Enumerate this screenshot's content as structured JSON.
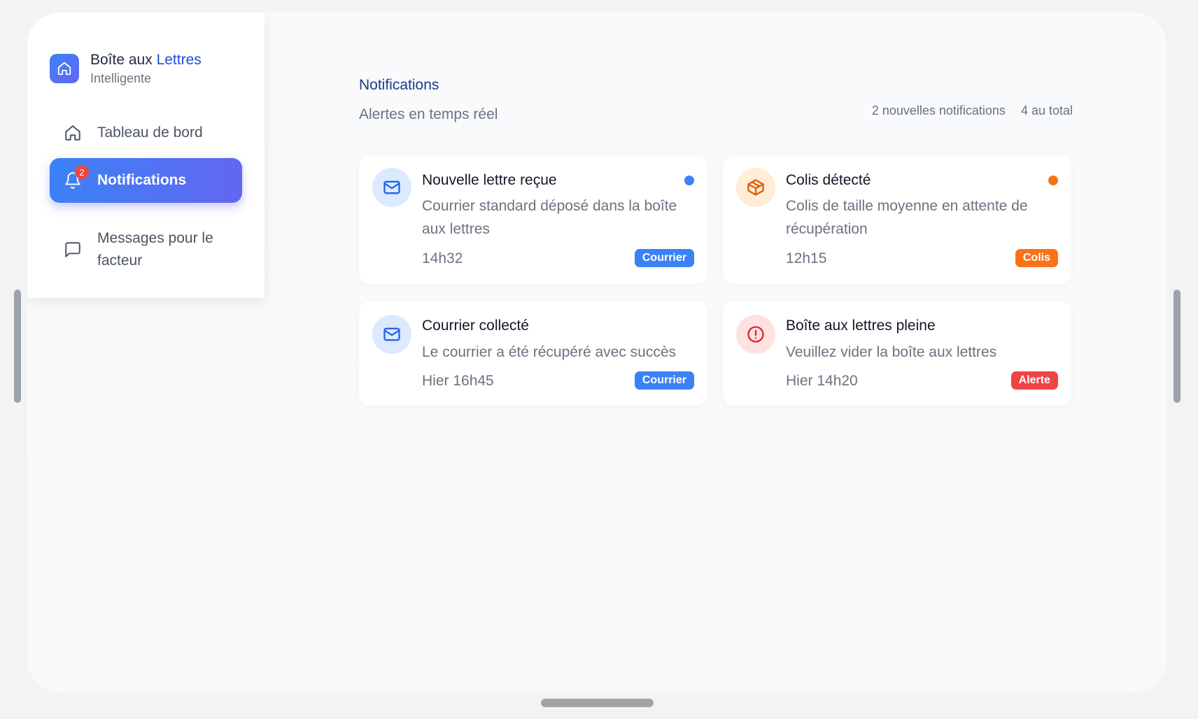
{
  "brand": {
    "title_part1": "Boîte aux ",
    "title_part2": "Lettres",
    "subtitle": "Intelligente"
  },
  "nav": {
    "dashboard": "Tableau de bord",
    "notifications": "Notifications",
    "notifications_badge": "2",
    "messages": "Messages pour le facteur"
  },
  "header": {
    "title": "Notifications",
    "subtitle": "Alertes en temps réel",
    "new_count": "2 nouvelles notifications",
    "total_count": "4 au total"
  },
  "notifications": [
    {
      "title": "Nouvelle lettre reçue",
      "description": "Courrier standard déposé dans la boîte aux lettres",
      "time": "14h32",
      "tag": "Courrier",
      "icon": "mail-icon",
      "tag_color": "#3b82f6",
      "unread": true
    },
    {
      "title": "Colis détecté",
      "description": "Colis de taille moyenne en attente de récupération",
      "time": "12h15",
      "tag": "Colis",
      "icon": "package-icon",
      "tag_color": "#f97316",
      "unread": true
    },
    {
      "title": "Courrier collecté",
      "description": "Le courrier a été récupéré avec succès",
      "time": "Hier 16h45",
      "tag": "Courrier",
      "icon": "mail-icon",
      "tag_color": "#3b82f6",
      "unread": false
    },
    {
      "title": "Boîte aux lettres pleine",
      "description": "Veuillez vider la boîte aux lettres",
      "time": "Hier 14h20",
      "tag": "Alerte",
      "icon": "alert-circle-icon",
      "tag_color": "#ef4444",
      "unread": false
    }
  ],
  "colors": {
    "accent": "#3b82f6",
    "accent2": "#6366f1",
    "orange": "#f97316",
    "red": "#ef4444"
  }
}
